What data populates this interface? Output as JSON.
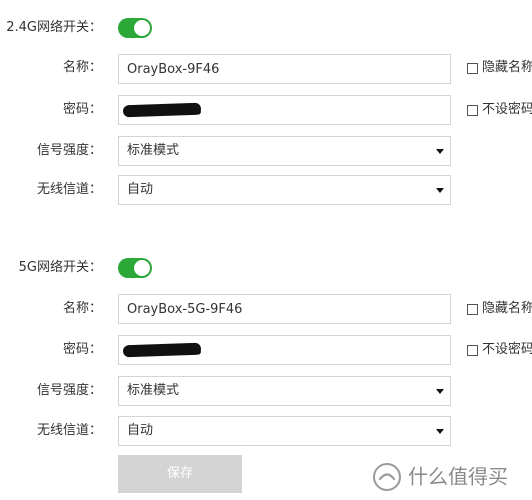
{
  "band_24": {
    "switch_label": "2.4G网络开关：",
    "name_label": "名称：",
    "name_value": "OrayBox-9F46",
    "password_label": "密码：",
    "signal_label": "信号强度：",
    "signal_value": "标准模式",
    "channel_label": "无线信道：",
    "channel_value": "自动",
    "hide_name_label": "隐藏名称",
    "no_password_label": "不设密码"
  },
  "band_5": {
    "switch_label": "5G网络开关：",
    "name_label": "名称：",
    "name_value": "OrayBox-5G-9F46",
    "password_label": "密码：",
    "signal_label": "信号强度：",
    "signal_value": "标准模式",
    "channel_label": "无线信道：",
    "channel_value": "自动",
    "hide_name_label": "隐藏名称",
    "no_password_label": "不设密码"
  },
  "save_label": "保存",
  "watermark": "什么值得买",
  "colors": {
    "toggle_on": "#2aa838",
    "field_border": "#d4d4d4",
    "button_disabled": "#d4d4d4"
  }
}
